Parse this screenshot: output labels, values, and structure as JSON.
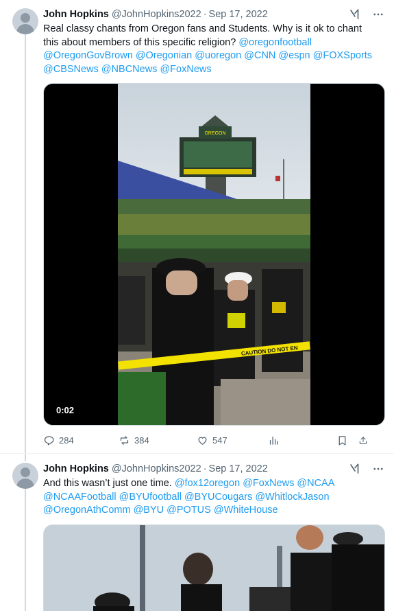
{
  "tweets": [
    {
      "name": "John Hopkins",
      "handle": "@JohnHopkins2022",
      "date": "Sep 17, 2022",
      "text_lines": [
        [
          {
            "t": "Real classy chants from Oregon fans and Students. Why is it ok to chant",
            "m": false
          }
        ],
        [
          {
            "t": "this about members of this specific religion? ",
            "m": false
          },
          {
            "t": "@oregonfootball",
            "m": true
          }
        ],
        [
          {
            "t": "@OregonGovBrown",
            "m": true
          },
          {
            "t": " ",
            "m": false
          },
          {
            "t": "@Oregonian",
            "m": true
          },
          {
            "t": " ",
            "m": false
          },
          {
            "t": "@uoregon",
            "m": true
          },
          {
            "t": " ",
            "m": false
          },
          {
            "t": "@CNN",
            "m": true
          },
          {
            "t": " ",
            "m": false
          },
          {
            "t": "@espn",
            "m": true
          },
          {
            "t": " ",
            "m": false
          },
          {
            "t": "@FOXSports",
            "m": true
          }
        ],
        [
          {
            "t": "@CBSNews",
            "m": true
          },
          {
            "t": " ",
            "m": false
          },
          {
            "t": "@NBCNews",
            "m": true
          },
          {
            "t": " ",
            "m": false
          },
          {
            "t": "@FoxNews",
            "m": true
          }
        ]
      ],
      "video": {
        "duration": "0:02",
        "scoreboard_text": "OREGON",
        "banner_text": "CAUTION   DO NOT EN"
      },
      "stats": {
        "replies": "284",
        "reposts": "384",
        "likes": "547"
      }
    },
    {
      "name": "John Hopkins",
      "handle": "@JohnHopkins2022",
      "date": "Sep 17, 2022",
      "text_lines": [
        [
          {
            "t": "And this wasn’t just one time. ",
            "m": false
          },
          {
            "t": "@fox12oregon",
            "m": true
          },
          {
            "t": " ",
            "m": false
          },
          {
            "t": "@FoxNews",
            "m": true
          },
          {
            "t": " ",
            "m": false
          },
          {
            "t": "@NCAA",
            "m": true
          }
        ],
        [
          {
            "t": "@NCAAFootball",
            "m": true
          },
          {
            "t": " ",
            "m": false
          },
          {
            "t": "@BYUfootball",
            "m": true
          },
          {
            "t": " ",
            "m": false
          },
          {
            "t": "@BYUCougars",
            "m": true
          },
          {
            "t": " ",
            "m": false
          },
          {
            "t": "@WhitlockJason",
            "m": true
          }
        ],
        [
          {
            "t": "@OregonAthComm",
            "m": true
          },
          {
            "t": " ",
            "m": false
          },
          {
            "t": "@BYU",
            "m": true
          },
          {
            "t": " ",
            "m": false
          },
          {
            "t": "@POTUS",
            "m": true
          },
          {
            "t": " ",
            "m": false
          },
          {
            "t": "@WhiteHouse",
            "m": true
          }
        ]
      ]
    }
  ],
  "icons": {
    "grok": "grok-icon",
    "more": "more-icon",
    "reply": "reply-icon",
    "repost": "repost-icon",
    "like": "like-icon",
    "views": "views-icon",
    "bookmark": "bookmark-icon",
    "share": "share-icon"
  },
  "colors": {
    "mention": "#1d9bf0",
    "secondary_text": "#536471",
    "thread_line": "#cfd9de",
    "oregon_green": "#1f5e2e",
    "oregon_yellow": "#f5e400"
  }
}
